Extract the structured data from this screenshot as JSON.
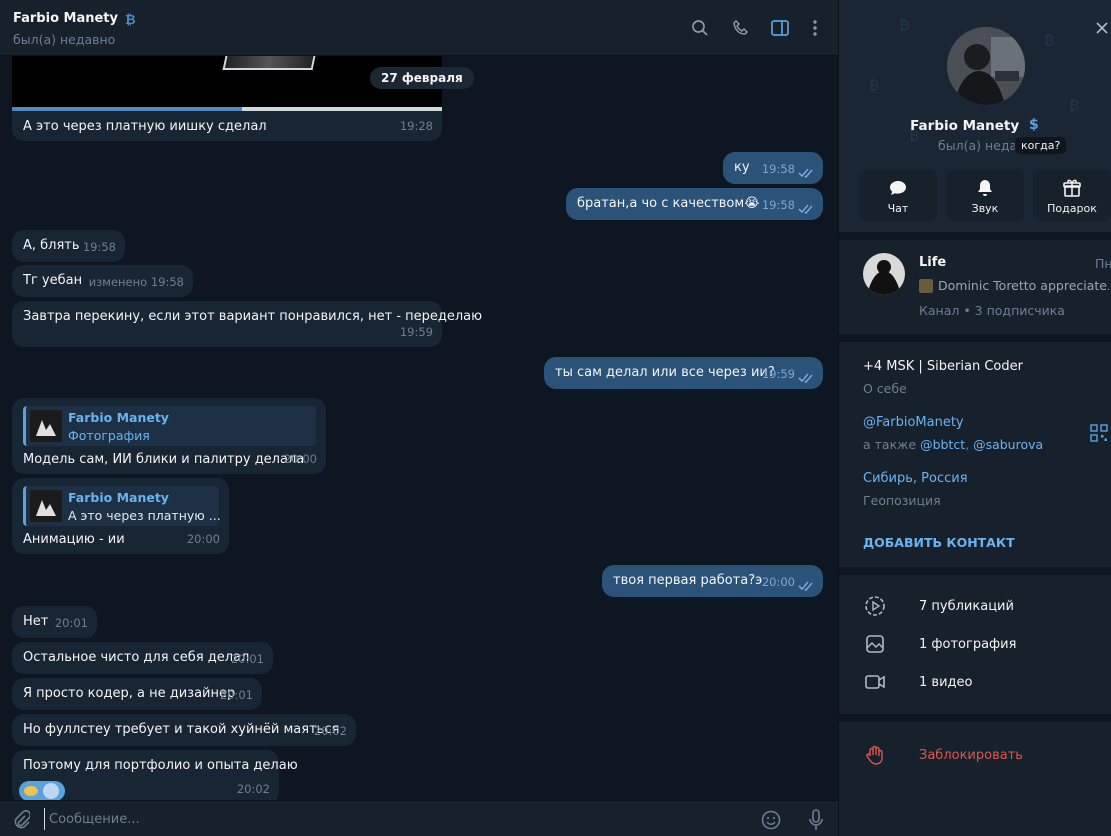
{
  "header": {
    "name": "Farbio Manety",
    "status": "был(а) недавно"
  },
  "date_pill": "27 февраля",
  "messages": {
    "m1": {
      "text": "А это через платную иишку сделал",
      "time": "19:28"
    },
    "m2": {
      "text": "ку",
      "time": "19:58"
    },
    "m3": {
      "text": "братан,а чо с качеством",
      "emoji": "😭",
      "time": "19:58"
    },
    "m4": {
      "text": "А, блять",
      "time": "19:58"
    },
    "m5": {
      "text": "Тг уебан",
      "time": "изменено 19:58"
    },
    "m6": {
      "text": "Завтра перекину, если этот вариант понравился, нет - переделаю",
      "time": "19:59"
    },
    "m7": {
      "text": "ты сам делал или все через ии?",
      "time": "19:59"
    },
    "m8": {
      "reply_name": "Farbio Manety",
      "reply_text": "Фотография",
      "text": "Модель сам, ИИ блики и палитру делала",
      "time": "20:00"
    },
    "m9": {
      "reply_name": "Farbio Manety",
      "reply_text": "А это через платную ...",
      "text": "Анимацию - ии",
      "time": "20:00"
    },
    "m10": {
      "text": "твоя первая работа?э",
      "time": "20:00"
    },
    "m11": {
      "text": "Нет",
      "time": "20:01"
    },
    "m12": {
      "text": "Остальное чисто для себя делал",
      "time": "20:01"
    },
    "m13": {
      "text": "Я просто кодер, а не дизайнер",
      "time": "20:01"
    },
    "m14": {
      "text": "Но фуллстеу требует и такой хуйнёй маяться",
      "time": "20:02"
    },
    "m15": {
      "text": "Поэтому для портфолио и опыта делаю",
      "time": "20:02"
    }
  },
  "composer": {
    "placeholder": "Сообщение..."
  },
  "profile": {
    "name": "Farbio Manety",
    "status": "был(а) недавно",
    "tooltip": "когда?",
    "buttons": {
      "chat": "Чат",
      "sound": "Звук",
      "gift": "Подарок"
    },
    "channel": {
      "title": "Life",
      "title_right": "Пн",
      "preview": "Dominic Toretto appreciate...",
      "meta": "Канал • 3 подписчика"
    },
    "bio": {
      "text": "+4 MSK | Siberian Coder",
      "label": "О себе"
    },
    "username": {
      "text": "@FarbioManety",
      "also_prefix": "а также",
      "also_1": "@bbtct",
      "also_sep": ",",
      "also_2": "@saburova"
    },
    "location": {
      "text": "Сибирь, Россия",
      "label": "Геопозиция"
    },
    "add_contact": "ДОБАВИТЬ КОНТАКТ",
    "media": {
      "posts": "7 публикаций",
      "photos": "1 фотография",
      "videos": "1 видео"
    },
    "block": "Заблокировать"
  },
  "colors": {
    "chat_bg": "#0e1621",
    "panel_bg": "#17212b",
    "incoming": "#182533",
    "outgoing": "#2b5278",
    "link": "#6ab3f3",
    "danger": "#e05350"
  }
}
